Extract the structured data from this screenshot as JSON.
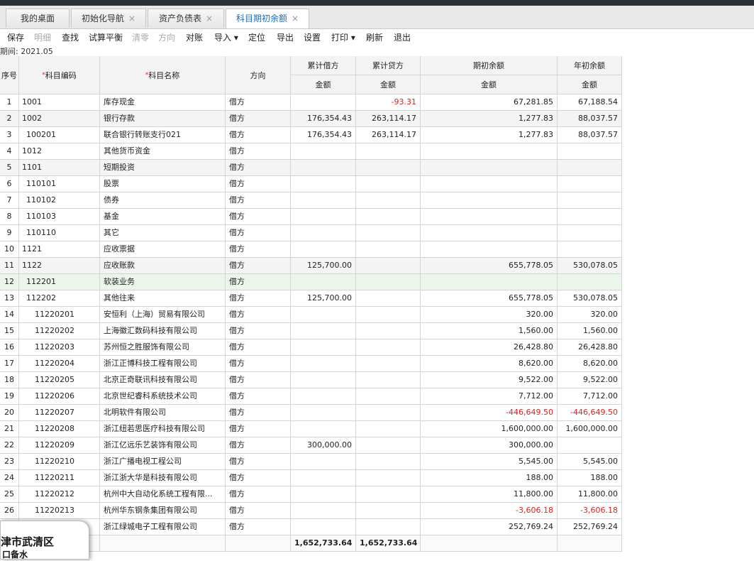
{
  "tabs": [
    {
      "label": "我的桌面",
      "closable": false
    },
    {
      "label": "初始化导航",
      "closable": true
    },
    {
      "label": "资产负债表",
      "closable": true
    },
    {
      "label": "科目期初余额",
      "closable": true,
      "active": true
    }
  ],
  "toolbar": [
    {
      "label": "保存",
      "enabled": true
    },
    {
      "label": "明细",
      "enabled": false
    },
    {
      "label": "查找",
      "enabled": true
    },
    {
      "label": "试算平衡",
      "enabled": true
    },
    {
      "label": "清零",
      "enabled": false
    },
    {
      "label": "方向",
      "enabled": false
    },
    {
      "label": "对账",
      "enabled": true
    },
    {
      "label": "导入 ▾",
      "enabled": true
    },
    {
      "label": "定位",
      "enabled": true
    },
    {
      "label": "导出",
      "enabled": true
    },
    {
      "label": "设置",
      "enabled": true
    },
    {
      "label": "打印 ▾",
      "enabled": true
    },
    {
      "label": "刷新",
      "enabled": true
    },
    {
      "label": "退出",
      "enabled": true
    }
  ],
  "period": "期间: 2021.05",
  "headers": {
    "seq": "序号",
    "code": "科目编码",
    "name": "科目名称",
    "dir": "方向",
    "debit": "累计借方",
    "credit": "累计贷方",
    "opening": "期初余额",
    "yearbegin": "年初余额",
    "amount": "金额"
  },
  "rows": [
    {
      "seq": "1",
      "code": "1001",
      "name": "库存现金",
      "dir": "借方",
      "debit": "",
      "credit": "-93.31",
      "opening": "67,281.85",
      "year": "67,188.54"
    },
    {
      "seq": "2",
      "code": "1002",
      "name": "银行存款",
      "dir": "借方",
      "debit": "176,354.43",
      "credit": "263,114.17",
      "opening": "1,277.83",
      "year": "88,037.57"
    },
    {
      "seq": "3",
      "code": "100201",
      "name": "联合银行转账支行021",
      "dir": "借方",
      "debit": "176,354.43",
      "credit": "263,114.17",
      "opening": "1,277.83",
      "year": "88,037.57"
    },
    {
      "seq": "4",
      "code": "1012",
      "name": "其他货币资金",
      "dir": "借方",
      "debit": "",
      "credit": "",
      "opening": "",
      "year": ""
    },
    {
      "seq": "5",
      "code": "1101",
      "name": "短期投资",
      "dir": "借方",
      "debit": "",
      "credit": "",
      "opening": "",
      "year": ""
    },
    {
      "seq": "6",
      "code": "110101",
      "name": "股票",
      "dir": "借方",
      "debit": "",
      "credit": "",
      "opening": "",
      "year": ""
    },
    {
      "seq": "7",
      "code": "110102",
      "name": "债券",
      "dir": "借方",
      "debit": "",
      "credit": "",
      "opening": "",
      "year": ""
    },
    {
      "seq": "8",
      "code": "110103",
      "name": "基金",
      "dir": "借方",
      "debit": "",
      "credit": "",
      "opening": "",
      "year": ""
    },
    {
      "seq": "9",
      "code": "110110",
      "name": "其它",
      "dir": "借方",
      "debit": "",
      "credit": "",
      "opening": "",
      "year": ""
    },
    {
      "seq": "10",
      "code": "1121",
      "name": "应收票据",
      "dir": "借方",
      "debit": "",
      "credit": "",
      "opening": "",
      "year": ""
    },
    {
      "seq": "11",
      "code": "1122",
      "name": "应收账款",
      "dir": "借方",
      "debit": "125,700.00",
      "credit": "",
      "opening": "655,778.05",
      "year": "530,078.05"
    },
    {
      "seq": "12",
      "code": "112201",
      "name": "软装业务",
      "dir": "借方",
      "debit": "",
      "credit": "",
      "opening": "",
      "year": ""
    },
    {
      "seq": "13",
      "code": "112202",
      "name": "其他往来",
      "dir": "借方",
      "debit": "125,700.00",
      "credit": "",
      "opening": "655,778.05",
      "year": "530,078.05"
    },
    {
      "seq": "14",
      "code": "11220201",
      "name": "安恒利（上海）贸易有限公司",
      "dir": "借方",
      "debit": "",
      "credit": "",
      "opening": "320.00",
      "year": "320.00"
    },
    {
      "seq": "15",
      "code": "11220202",
      "name": "上海徽汇数码科技有限公司",
      "dir": "借方",
      "debit": "",
      "credit": "",
      "opening": "1,560.00",
      "year": "1,560.00"
    },
    {
      "seq": "16",
      "code": "11220203",
      "name": "苏州恒之胜服饰有限公司",
      "dir": "借方",
      "debit": "",
      "credit": "",
      "opening": "26,428.80",
      "year": "26,428.80"
    },
    {
      "seq": "17",
      "code": "11220204",
      "name": "浙江正博科技工程有限公司",
      "dir": "借方",
      "debit": "",
      "credit": "",
      "opening": "8,620.00",
      "year": "8,620.00"
    },
    {
      "seq": "18",
      "code": "11220205",
      "name": "北京正奇联讯科技有限公司",
      "dir": "借方",
      "debit": "",
      "credit": "",
      "opening": "9,522.00",
      "year": "9,522.00"
    },
    {
      "seq": "19",
      "code": "11220206",
      "name": "北京世纪睿科系统技术公司",
      "dir": "借方",
      "debit": "",
      "credit": "",
      "opening": "7,712.00",
      "year": "7,712.00"
    },
    {
      "seq": "20",
      "code": "11220207",
      "name": "北明软件有限公司",
      "dir": "借方",
      "debit": "",
      "credit": "",
      "opening": "-446,649.50",
      "year": "-446,649.50"
    },
    {
      "seq": "21",
      "code": "11220208",
      "name": "浙江纽若思医疗科技有限公司",
      "dir": "借方",
      "debit": "",
      "credit": "",
      "opening": "1,600,000.00",
      "year": "1,600,000.00"
    },
    {
      "seq": "22",
      "code": "11220209",
      "name": "浙江亿远乐艺装饰有限公司",
      "dir": "借方",
      "debit": "300,000.00",
      "credit": "",
      "opening": "300,000.00",
      "year": ""
    },
    {
      "seq": "23",
      "code": "11220210",
      "name": "浙江广播电视工程公司",
      "dir": "借方",
      "debit": "",
      "credit": "",
      "opening": "5,545.00",
      "year": "5,545.00"
    },
    {
      "seq": "24",
      "code": "11220211",
      "name": "浙江浙大华是科技有限公司",
      "dir": "借方",
      "debit": "",
      "credit": "",
      "opening": "188.00",
      "year": "188.00"
    },
    {
      "seq": "25",
      "code": "11220212",
      "name": "杭州中大自动化系统工程有限...",
      "dir": "借方",
      "debit": "",
      "credit": "",
      "opening": "11,800.00",
      "year": "11,800.00"
    },
    {
      "seq": "26",
      "code": "11220213",
      "name": "杭州华东钢条集团有限公司",
      "dir": "借方",
      "debit": "",
      "credit": "",
      "opening": "-3,606.18",
      "year": "-3,606.18"
    },
    {
      "seq": "",
      "code": "",
      "name": "浙江绿城电子工程有限公司",
      "dir": "借方",
      "debit": "",
      "credit": "",
      "opening": "252,769.24",
      "year": "252,769.24"
    }
  ],
  "totals": {
    "debit": "1,652,733.64",
    "credit": "1,652,733.64"
  },
  "popup": {
    "line1": "津市武清区",
    "line2": "口备水"
  }
}
